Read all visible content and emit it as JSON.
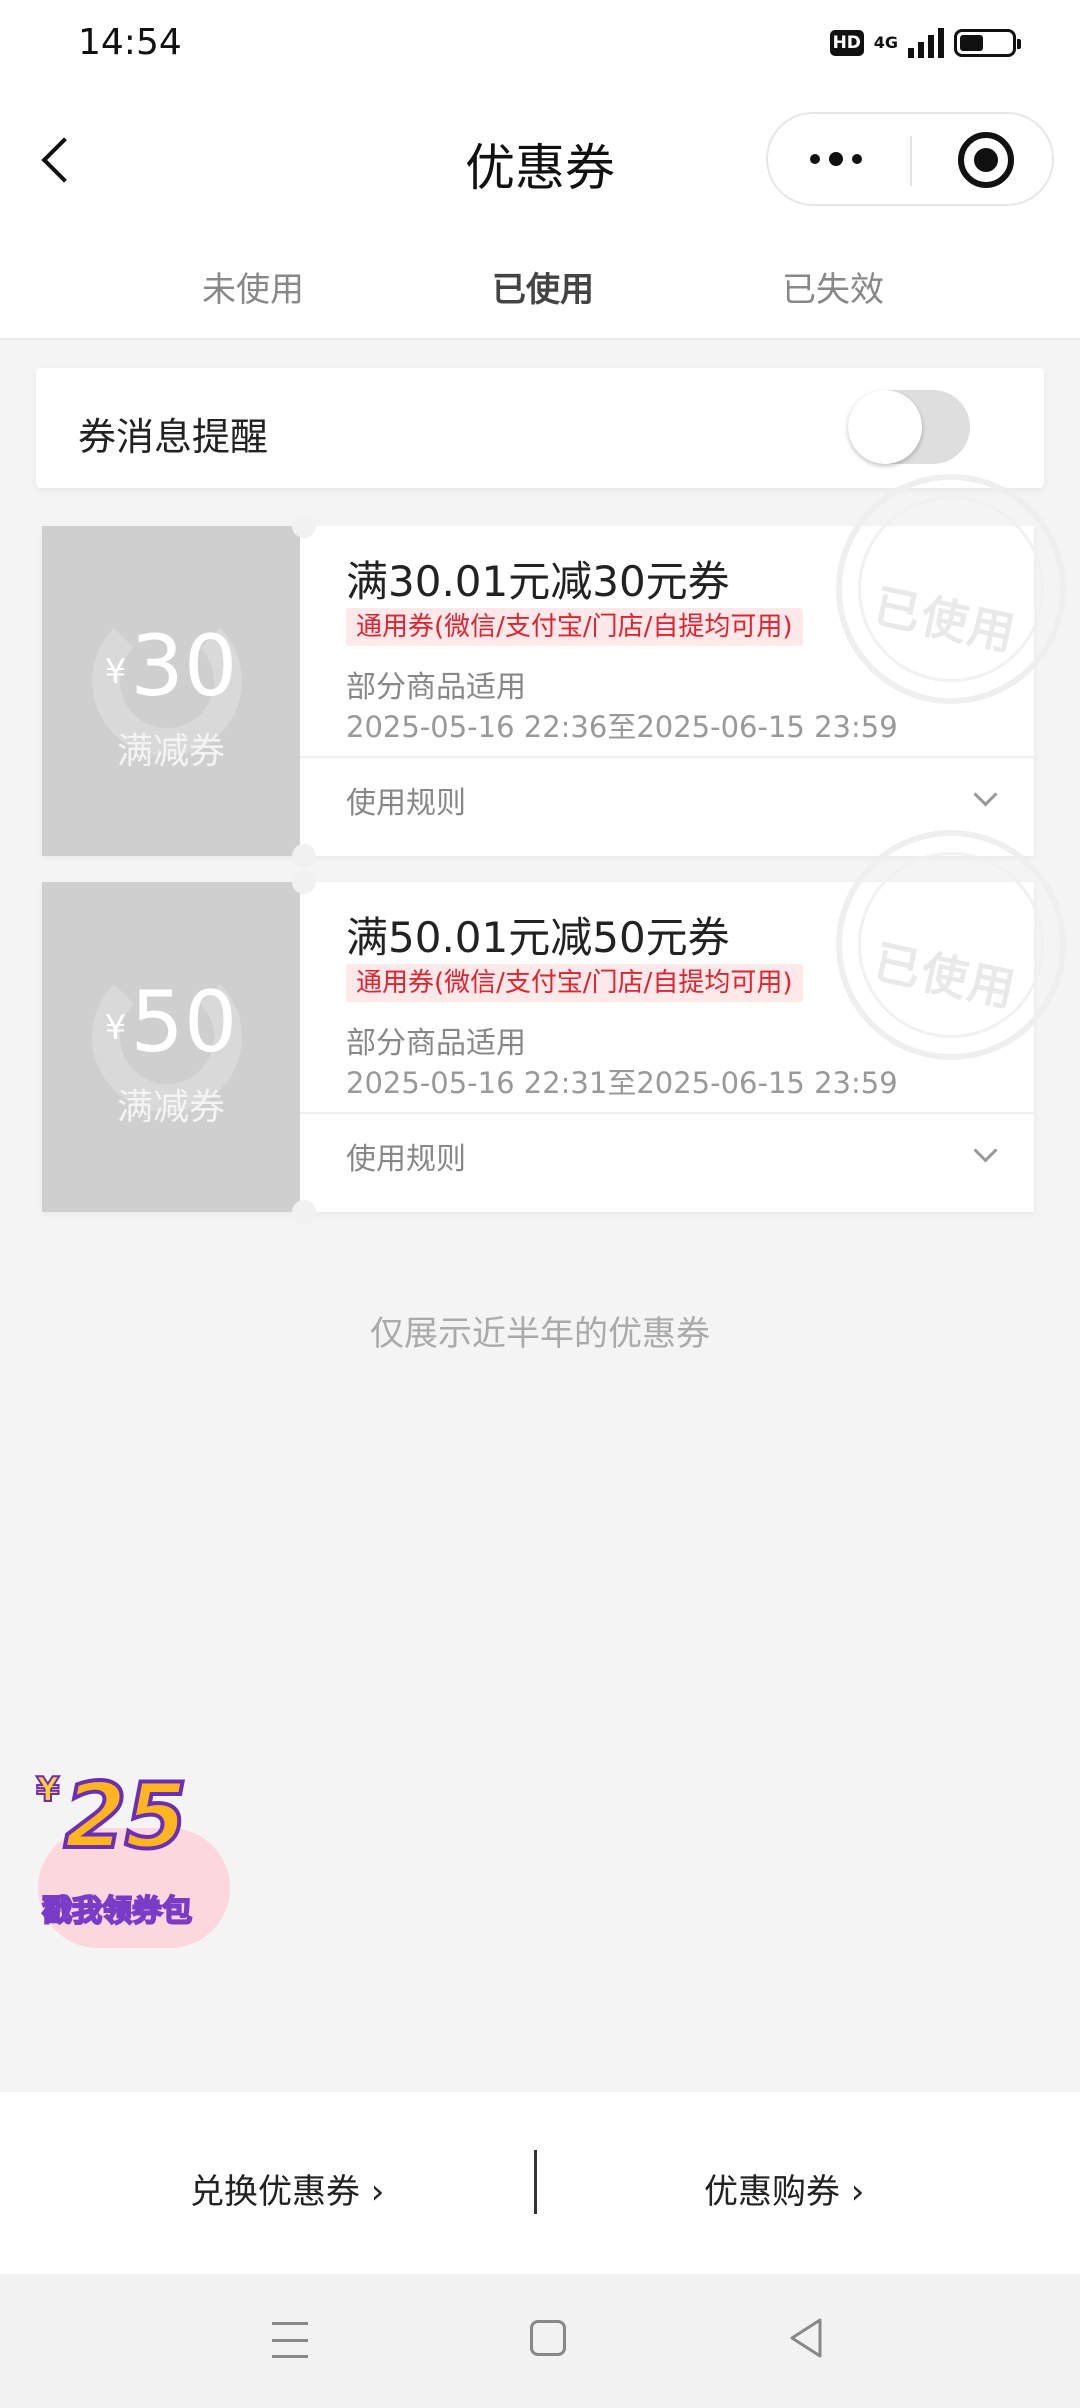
{
  "status_bar": {
    "time": "14:54",
    "hd": "HD",
    "network": "4G",
    "battery_level": 0.45
  },
  "header": {
    "title": "优惠券",
    "back_icon": "chevron-left-icon",
    "more_icon": "more-dots-icon",
    "close_icon": "target-icon"
  },
  "tabs": [
    {
      "label": "未使用",
      "active": false
    },
    {
      "label": "已使用",
      "active": true
    },
    {
      "label": "已失效",
      "active": false
    }
  ],
  "reminder": {
    "label": "券消息提醒",
    "enabled": false
  },
  "coupons": [
    {
      "currency": "¥",
      "amount": "30",
      "type": "满减券",
      "name": "满30.01元减30元券",
      "tag": "通用券(微信/支付宝/门店/自提均可用)",
      "scope": "部分商品适用",
      "validity": "2025-05-16 22:36至2025-06-15 23:59",
      "rules_label": "使用规则",
      "stamp": "已使用"
    },
    {
      "currency": "¥",
      "amount": "50",
      "type": "满减券",
      "name": "满50.01元减50元券",
      "tag": "通用券(微信/支付宝/门店/自提均可用)",
      "scope": "部分商品适用",
      "validity": "2025-05-16 22:31至2025-06-15 23:59",
      "rules_label": "使用规则",
      "stamp": "已使用"
    }
  ],
  "footnote": "仅展示近半年的优惠券",
  "promo": {
    "currency": "¥",
    "amount": "25",
    "text": "戳我领券包"
  },
  "bottom_bar": {
    "redeem_label": "兑换优惠券 ›",
    "buy_label": "优惠购券 ›"
  },
  "colors": {
    "accent_red": "#e0232f",
    "tag_bg": "#fde8ea",
    "coupon_left": "#cfcfcf"
  }
}
